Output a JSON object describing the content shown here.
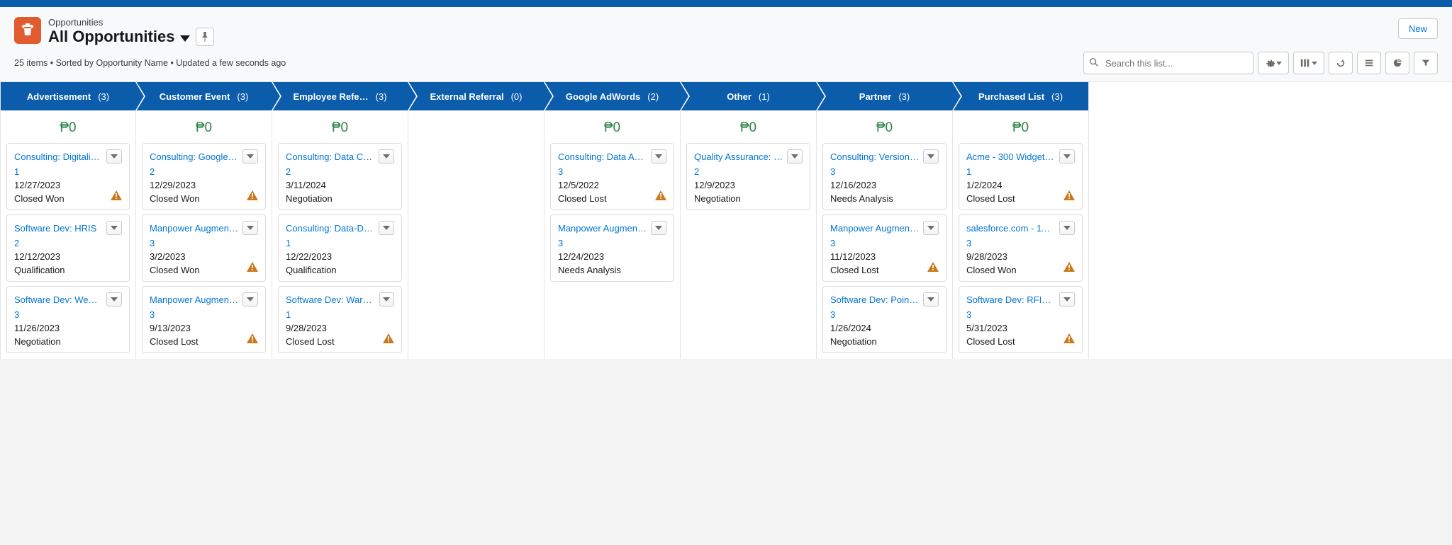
{
  "header": {
    "object_label": "Opportunities",
    "list_view_name": "All Opportunities",
    "new_button": "New",
    "meta": "25 items • Sorted by Opportunity Name • Updated a few seconds ago",
    "search_placeholder": "Search this list..."
  },
  "stages": [
    {
      "name": "Advertisement",
      "count": "(3)",
      "amount": "₱0"
    },
    {
      "name": "Customer Event",
      "count": "(3)",
      "amount": "₱0"
    },
    {
      "name": "Employee Refe…",
      "count": "(3)",
      "amount": "₱0"
    },
    {
      "name": "External Referral",
      "count": "(0)",
      "amount": ""
    },
    {
      "name": "Google AdWords",
      "count": "(2)",
      "amount": "₱0"
    },
    {
      "name": "Other",
      "count": "(1)",
      "amount": "₱0"
    },
    {
      "name": "Partner",
      "count": "(3)",
      "amount": "₱0"
    },
    {
      "name": "Purchased List",
      "count": "(3)",
      "amount": "₱0"
    }
  ],
  "cards": [
    [
      {
        "title": "Consulting: Digitali…",
        "link": "1",
        "date": "12/27/2023",
        "stage": "Closed Won",
        "warn": true
      },
      {
        "title": "Software Dev: HRIS",
        "link": "2",
        "date": "12/12/2023",
        "stage": "Qualification",
        "warn": false
      },
      {
        "title": "Software Dev: Web…",
        "link": "3",
        "date": "11/26/2023",
        "stage": "Negotiation",
        "warn": false
      }
    ],
    [
      {
        "title": "Consulting: Google …",
        "link": "2",
        "date": "12/29/2023",
        "stage": "Closed Won",
        "warn": true
      },
      {
        "title": "Manpower Augmen…",
        "link": "3",
        "date": "3/2/2023",
        "stage": "Closed Won",
        "warn": true
      },
      {
        "title": "Manpower Augmen…",
        "link": "3",
        "date": "9/13/2023",
        "stage": "Closed Lost",
        "warn": true
      }
    ],
    [
      {
        "title": "Consulting: Data C…",
        "link": "2",
        "date": "3/11/2024",
        "stage": "Negotiation",
        "warn": false
      },
      {
        "title": "Consulting: Data-D…",
        "link": "1",
        "date": "12/22/2023",
        "stage": "Qualification",
        "warn": false
      },
      {
        "title": "Software Dev: Ware…",
        "link": "1",
        "date": "9/28/2023",
        "stage": "Closed Lost",
        "warn": true
      }
    ],
    [],
    [
      {
        "title": "Consulting: Data A…",
        "link": "3",
        "date": "12/5/2022",
        "stage": "Closed Lost",
        "warn": true
      },
      {
        "title": "Manpower Augmen…",
        "link": "3",
        "date": "12/24/2023",
        "stage": "Needs Analysis",
        "warn": false
      }
    ],
    [
      {
        "title": "Quality Assurance: …",
        "link": "2",
        "date": "12/9/2023",
        "stage": "Negotiation",
        "warn": false
      }
    ],
    [
      {
        "title": "Consulting: Version…",
        "link": "3",
        "date": "12/16/2023",
        "stage": "Needs Analysis",
        "warn": false
      },
      {
        "title": "Manpower Augmen…",
        "link": "3",
        "date": "11/12/2023",
        "stage": "Closed Lost",
        "warn": true
      },
      {
        "title": "Software Dev: Point…",
        "link": "3",
        "date": "1/26/2024",
        "stage": "Negotiation",
        "warn": false
      }
    ],
    [
      {
        "title": "Acme - 300 Widget…",
        "link": "1",
        "date": "1/2/2024",
        "stage": "Closed Lost",
        "warn": true
      },
      {
        "title": "salesforce.com - 11…",
        "link": "3",
        "date": "9/28/2023",
        "stage": "Closed Won",
        "warn": true
      },
      {
        "title": "Software Dev: RFID…",
        "link": "3",
        "date": "5/31/2023",
        "stage": "Closed Lost",
        "warn": true
      }
    ]
  ]
}
